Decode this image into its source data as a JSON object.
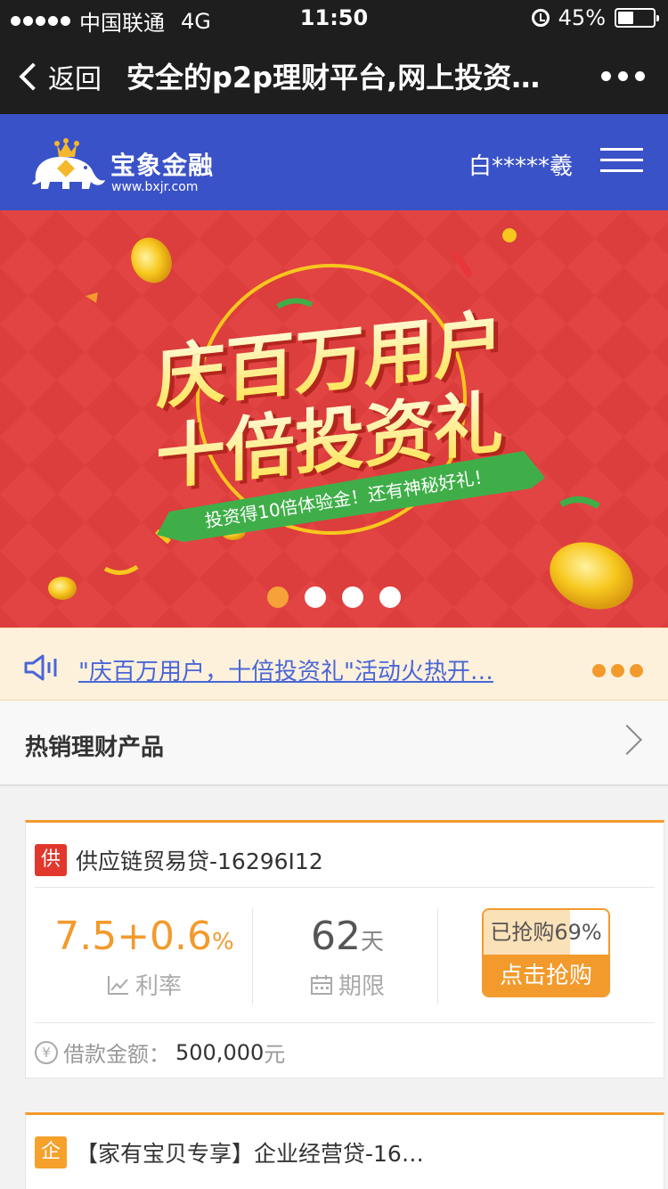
{
  "status_bar": {
    "carrier": "中国联通",
    "network": "4G",
    "time": "11:50",
    "battery": "45%",
    "battery_level": 0.45
  },
  "nav": {
    "back_label": "返回",
    "title": "安全的p2p理财平台,网上投资…",
    "more_icon": "ellipsis-icon"
  },
  "header": {
    "brand_name": "宝象金融",
    "brand_url": "www.bxjr.com",
    "username": "白*****羲",
    "menu_icon": "hamburger-menu-icon",
    "color": "#3a52c7"
  },
  "banner": {
    "headline_1": "庆百万用户",
    "headline_2": "十倍投资礼",
    "ribbon_text": "投资得10倍体验金！还有神秘好礼！",
    "slide_count": 4,
    "active_slide": 1
  },
  "notice": {
    "icon": "speaker-icon",
    "text": "\"庆百万用户，十倍投资礼\"活动火热开…",
    "more_icon": "more-dots-icon"
  },
  "section": {
    "title": "热销理财产品"
  },
  "products": [
    {
      "tag": "供",
      "tag_color": "#e2372c",
      "name": "供应链贸易贷-16296I12",
      "rate": "7.5+0.6",
      "rate_unit": "%",
      "rate_label": "利率",
      "term": "62",
      "term_unit": "天",
      "term_label": "期限",
      "sold_text": "已抢购69%",
      "sold_progress": 0.69,
      "buy_label": "点击抢购",
      "amount_label": "借款金额：",
      "amount_value": "500,000",
      "amount_unit": "元"
    },
    {
      "tag": "企",
      "tag_color": "#f5a12c",
      "name": "【家有宝贝专享】企业经营贷-16…"
    }
  ],
  "colors": {
    "accent": "#f39a2c",
    "link": "#4a66d6",
    "banner_red": "#e14443"
  }
}
